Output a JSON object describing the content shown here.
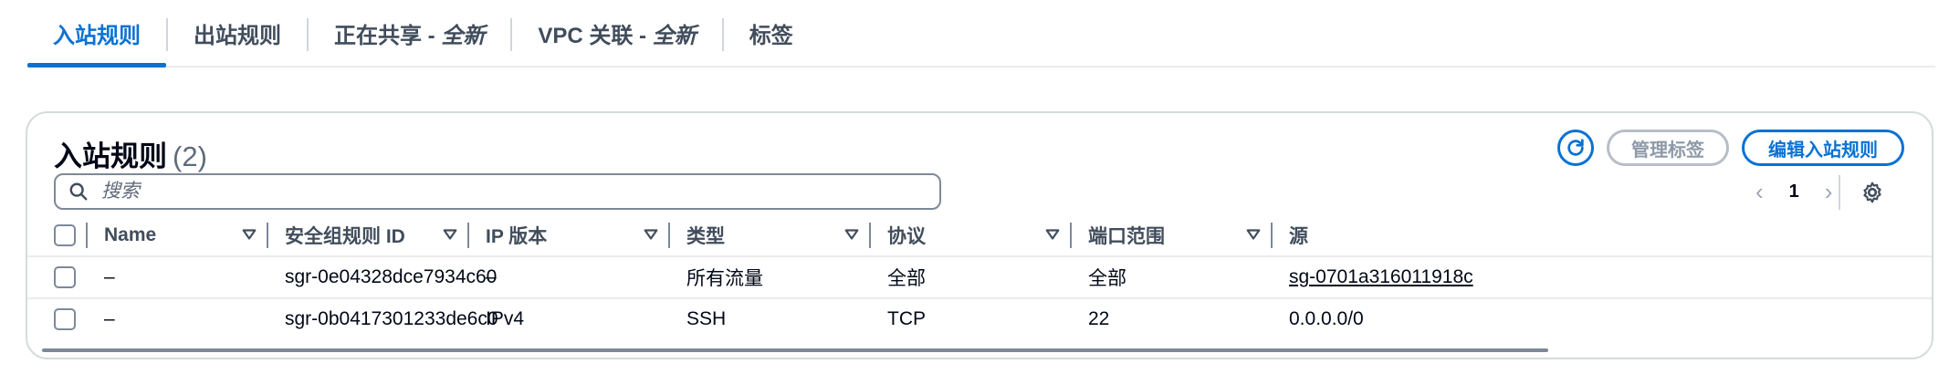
{
  "tabs": [
    {
      "label": "入站规则",
      "active": true
    },
    {
      "label": "出站规则",
      "active": false
    },
    {
      "label": "正在共享 - ",
      "em": "全新",
      "active": false
    },
    {
      "label": "VPC 关联 - ",
      "em": "全新",
      "active": false
    },
    {
      "label": "标签",
      "active": false
    }
  ],
  "panel": {
    "title": "入站规则",
    "count": "(2)",
    "refresh_icon": "refresh-icon",
    "manage_tags_label": "管理标签",
    "edit_rules_label": "编辑入站规则",
    "search_placeholder": "搜索"
  },
  "pagination": {
    "current_page": "1"
  },
  "table": {
    "columns": [
      "Name",
      "安全组规则 ID",
      "IP 版本",
      "类型",
      "协议",
      "端口范围",
      "源"
    ],
    "rows": [
      [
        "–",
        "sgr-0e04328dce7934c60",
        "–",
        "所有流量",
        "全部",
        "全部",
        "sg-0701a316011918c"
      ],
      [
        "–",
        "sgr-0b0417301233de6c0",
        "IPv4",
        "SSH",
        "TCP",
        "22",
        "0.0.0.0/0"
      ]
    ]
  },
  "colors": {
    "accent": "#0972d3",
    "text": "#000716",
    "muted": "#5f6b7a",
    "border": "#d5dbdb"
  }
}
